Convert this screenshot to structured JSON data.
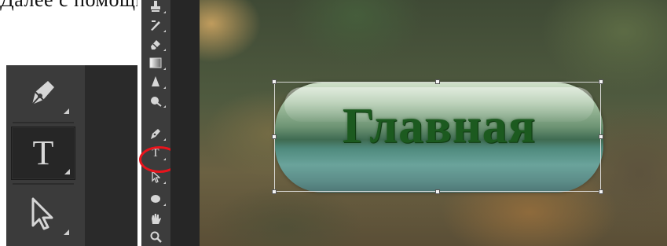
{
  "document": {
    "top_line": "Далее с помощью инструмента «Текст» добавляем надпись на кнопку (рис."
  },
  "zoomed_toolbar": {
    "tools": [
      {
        "name": "pen-tool",
        "icon": "pen-nib-icon"
      },
      {
        "name": "type-tool",
        "icon": "type-icon",
        "glyph": "T",
        "active": true
      },
      {
        "name": "path-selection-tool",
        "icon": "arrow-cursor-icon"
      }
    ]
  },
  "toolbar": {
    "tools": [
      {
        "name": "clone-stamp-tool",
        "icon": "stamp-icon"
      },
      {
        "name": "history-brush-tool",
        "icon": "history-brush-icon"
      },
      {
        "name": "eraser-tool",
        "icon": "eraser-icon"
      },
      {
        "name": "gradient-tool",
        "icon": "gradient-icon"
      },
      {
        "name": "blur-tool",
        "icon": "blur-drop-icon"
      },
      {
        "name": "dodge-tool",
        "icon": "dodge-icon"
      },
      {
        "name": "pen-tool",
        "icon": "pen-nib-icon"
      },
      {
        "name": "type-tool",
        "icon": "type-icon",
        "glyph": "T",
        "highlighted": true
      },
      {
        "name": "path-selection-tool",
        "icon": "arrow-cursor-icon"
      },
      {
        "name": "ellipse-tool",
        "icon": "ellipse-icon"
      },
      {
        "name": "hand-tool",
        "icon": "hand-icon"
      },
      {
        "name": "zoom-tool",
        "icon": "magnifier-icon"
      }
    ]
  },
  "canvas": {
    "button_label": "Главная",
    "highlight_color": "#e8141c",
    "text_color": "#1c5a1f"
  }
}
